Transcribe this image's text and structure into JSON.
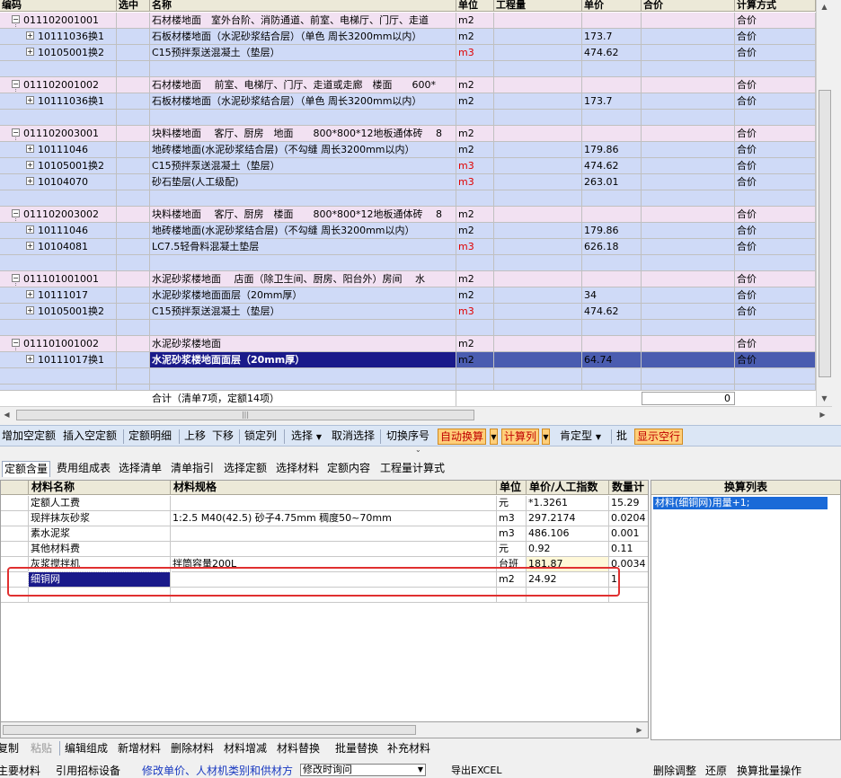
{
  "grid": {
    "headers": {
      "code": "编码",
      "select": "选中",
      "name": "名称",
      "unit": "单位",
      "qty": "工程量",
      "price": "单价",
      "total": "合价",
      "method": "计算方式"
    },
    "rows": [
      {
        "type": "bill",
        "code": "011102001001",
        "name": "石材楼地面　室外台阶、消防通道、前室、电梯厅、门厅、走道",
        "unit": "m2",
        "price": "",
        "method": "合价"
      },
      {
        "type": "quota",
        "code": "10111036换1",
        "name": "石板材楼地面（水泥砂浆结合层）（单色 周长3200mm以内）",
        "unit": "m2",
        "price": "173.7",
        "method": "合价"
      },
      {
        "type": "quota",
        "code": "10105001换2",
        "name": "C15预拌泵送混凝土（垫层）",
        "unit": "m3",
        "price": "474.62",
        "method": "合价"
      },
      {
        "type": "blank"
      },
      {
        "type": "bill",
        "code": "011102001002",
        "name": "石材楼地面　 前室、电梯厅、门厅、走道或走廊　楼面　　600*",
        "unit": "m2",
        "price": "",
        "method": "合价"
      },
      {
        "type": "quota",
        "code": "10111036换1",
        "name": "石板材楼地面（水泥砂浆结合层）（单色 周长3200mm以内）",
        "unit": "m2",
        "price": "173.7",
        "method": "合价"
      },
      {
        "type": "blank"
      },
      {
        "type": "bill",
        "code": "011102003001",
        "name": "块料楼地面　 客厅、厨房　地面　　800*800*12地板通体砖　 8",
        "unit": "m2",
        "price": "",
        "method": "合价"
      },
      {
        "type": "quota",
        "code": "10111046",
        "name": "地砖楼地面(水泥砂浆结合层)（不勾缝 周长3200mm以内）",
        "unit": "m2",
        "price": "179.86",
        "method": "合价"
      },
      {
        "type": "quota",
        "code": "10105001换2",
        "name": "C15预拌泵送混凝土（垫层）",
        "unit": "m3",
        "price": "474.62",
        "method": "合价"
      },
      {
        "type": "quota",
        "code": "10104070",
        "name": "砂石垫层(人工级配)",
        "unit": "m3",
        "price": "263.01",
        "method": "合价"
      },
      {
        "type": "blank"
      },
      {
        "type": "bill",
        "code": "011102003002",
        "name": "块料楼地面　 客厅、厨房　楼面　　800*800*12地板通体砖　 8",
        "unit": "m2",
        "price": "",
        "method": "合价"
      },
      {
        "type": "quota",
        "code": "10111046",
        "name": "地砖楼地面(水泥砂浆结合层)（不勾缝 周长3200mm以内）",
        "unit": "m2",
        "price": "179.86",
        "method": "合价"
      },
      {
        "type": "quota",
        "code": "10104081",
        "name": "LC7.5轻骨料混凝土垫层",
        "unit": "m3",
        "price": "626.18",
        "method": "合价"
      },
      {
        "type": "blank"
      },
      {
        "type": "bill",
        "code": "011101001001",
        "name": "水泥砂浆楼地面　 店面（除卫生间、厨房、阳台外）房间　 水",
        "unit": "m2",
        "price": "",
        "method": "合价"
      },
      {
        "type": "quota",
        "code": "10111017",
        "name": "水泥砂浆楼地面面层（20mm厚）",
        "unit": "m2",
        "price": "34",
        "method": "合价"
      },
      {
        "type": "quota",
        "code": "10105001换2",
        "name": "C15预拌泵送混凝土（垫层）",
        "unit": "m3",
        "price": "474.62",
        "method": "合价"
      },
      {
        "type": "blank"
      },
      {
        "type": "bill",
        "code": "011101001002",
        "name": "水泥砂浆楼地面",
        "unit": "m2",
        "price": "",
        "method": "合价"
      },
      {
        "type": "quota-selected",
        "code": "10111017换1",
        "name": "水泥砂浆楼地面面层（20mm厚）",
        "unit": "m2",
        "price": "64.74",
        "method": "合价"
      },
      {
        "type": "blank"
      },
      {
        "type": "blank"
      }
    ],
    "summary_label": "合计（清单7项，定额14项）",
    "summary_total": "0"
  },
  "toolbar": {
    "add_quota": "增加空定额",
    "insert_quota": "插入空定额",
    "quota_detail": "定额明细",
    "move_up": "上移",
    "move_down": "下移",
    "lock_column": "锁定列",
    "select": "选择",
    "deselect": "取消选择",
    "switch_seq": "切换序号",
    "auto_convert": "自动换算",
    "calc_column": "计算列",
    "fixed_type": "肯定型",
    "batch": "批",
    "show_blank": "显示空行"
  },
  "tabs": [
    "定额含量",
    "费用组成表",
    "选择清单",
    "清单指引",
    "选择定额",
    "选择材料",
    "定额内容",
    "工程量计算式"
  ],
  "materials": {
    "headers": {
      "name": "材料名称",
      "spec": "材料规格",
      "unit": "单位",
      "price": "单价/人工指数",
      "qty": "数量计"
    },
    "rows": [
      {
        "name": "定额人工费",
        "spec": "",
        "unit": "元",
        "price": "*1.3261",
        "qty": "15.29"
      },
      {
        "name": "现拌抹灰砂浆",
        "spec": "1:2.5 M40(42.5) 砂子4.75mm 稠度50~70mm",
        "unit": "m3",
        "price": "297.2174",
        "qty": "0.0204"
      },
      {
        "name": "素水泥浆",
        "spec": "",
        "unit": "m3",
        "price": "486.106",
        "qty": "0.001"
      },
      {
        "name": "其他材料费",
        "spec": "",
        "unit": "元",
        "price": "0.92",
        "qty": "0.11"
      },
      {
        "name": "灰浆搅拌机",
        "spec": "拌筒容量200L",
        "unit": "台班",
        "price": "181.87",
        "qty": "0.0034"
      },
      {
        "name": "细铜网",
        "spec": "",
        "unit": "m2",
        "price": "24.92",
        "qty": "1"
      }
    ]
  },
  "conversion": {
    "header": "换算列表",
    "items": [
      "材料(细铜网)用量+1;"
    ]
  },
  "actions": [
    "复制",
    "粘贴",
    "编辑组成",
    "新增材料",
    "删除材料",
    "材料增减",
    "材料替换",
    "批量替换",
    "补充材料"
  ],
  "bottom": {
    "main_material": "主要材料",
    "ref_device": "引用招标设备",
    "edit_link": "修改单价、人材机类别和供材方",
    "edit_time": "修改时询问",
    "export_excel": "导出EXCEL",
    "delete_adjust": "删除调整",
    "restore": "还原",
    "batch_convert": "换算批量操作"
  },
  "colors": {
    "bill_row": "#f2e1f2",
    "quota_row": "#cfdaf7",
    "selected": "#1a1a8a",
    "red_unit": "#e00000",
    "highlight_button": "#ffcf7a"
  }
}
